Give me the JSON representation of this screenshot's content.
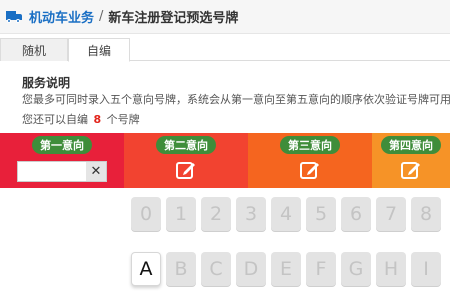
{
  "header": {
    "root": "机动车业务",
    "separator": "/",
    "current": "新车注册登记预选号牌"
  },
  "tabs": {
    "random": "随机",
    "custom": "自编"
  },
  "service": {
    "title": "服务说明",
    "description": "您最多可同时录入五个意向号牌，系统会从第一意向至第五意向的顺序依次验证号牌可用性，验证可"
  },
  "remaining": {
    "prefix": "您还可以自编",
    "count": "8",
    "suffix": "个号牌"
  },
  "choices": [
    {
      "label": "第一意向",
      "value": ""
    },
    {
      "label": "第二意向"
    },
    {
      "label": "第三意向"
    },
    {
      "label": "第四意向"
    }
  ],
  "keyboard": {
    "row1": [
      "0",
      "1",
      "2",
      "3",
      "4",
      "5",
      "6",
      "7",
      "8"
    ],
    "row2": [
      "A",
      "B",
      "C",
      "D",
      "E",
      "F",
      "G",
      "H",
      "I"
    ],
    "active_key": "A"
  },
  "colors": {
    "accent": "#1a6fc4",
    "choice1": "#e8203a",
    "choice2": "#f24330",
    "choice3": "#f5651f",
    "choice4": "#f69327",
    "label_bg": "#3f8d3a",
    "count": "#e2231a"
  },
  "icons": {
    "header": "truck-icon",
    "clear": "close-icon",
    "edit": "edit-icon"
  }
}
